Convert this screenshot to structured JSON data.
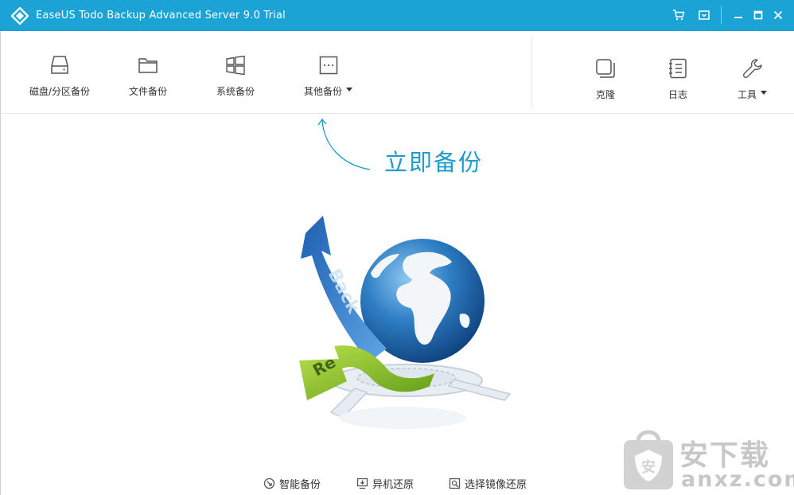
{
  "window": {
    "title": "EaseUS Todo Backup Advanced Server 9.0 Trial",
    "accent_color": "#1ba3d6",
    "controls": [
      "cart-icon",
      "menu-icon",
      "minimize-icon",
      "maximize-icon",
      "close-icon"
    ]
  },
  "toolbar": {
    "left_tools": [
      {
        "label": "磁盘/分区备份",
        "icon": "disk-icon",
        "has_dropdown": false
      },
      {
        "label": "文件备份",
        "icon": "folder-icon",
        "has_dropdown": false
      },
      {
        "label": "系统备份",
        "icon": "windows-icon",
        "has_dropdown": false
      },
      {
        "label": "其他备份",
        "icon": "more-icon",
        "has_dropdown": true
      }
    ],
    "right_tools": [
      {
        "label": "克隆",
        "icon": "clone-icon",
        "has_dropdown": false
      },
      {
        "label": "日志",
        "icon": "log-icon",
        "has_dropdown": false
      },
      {
        "label": "工具",
        "icon": "wrench-icon",
        "has_dropdown": true
      }
    ]
  },
  "main": {
    "backup_now": "立即备份",
    "illustration_icon": "globe-backup-recovery-illustration",
    "bottom_links": [
      {
        "label": "智能备份",
        "icon": "smart-backup-icon"
      },
      {
        "label": "异机还原",
        "icon": "restore-other-pc-icon"
      },
      {
        "label": "选择镜像还原",
        "icon": "image-restore-icon"
      }
    ]
  },
  "watermark": {
    "cn": "安下载",
    "en": "anxz.com"
  }
}
